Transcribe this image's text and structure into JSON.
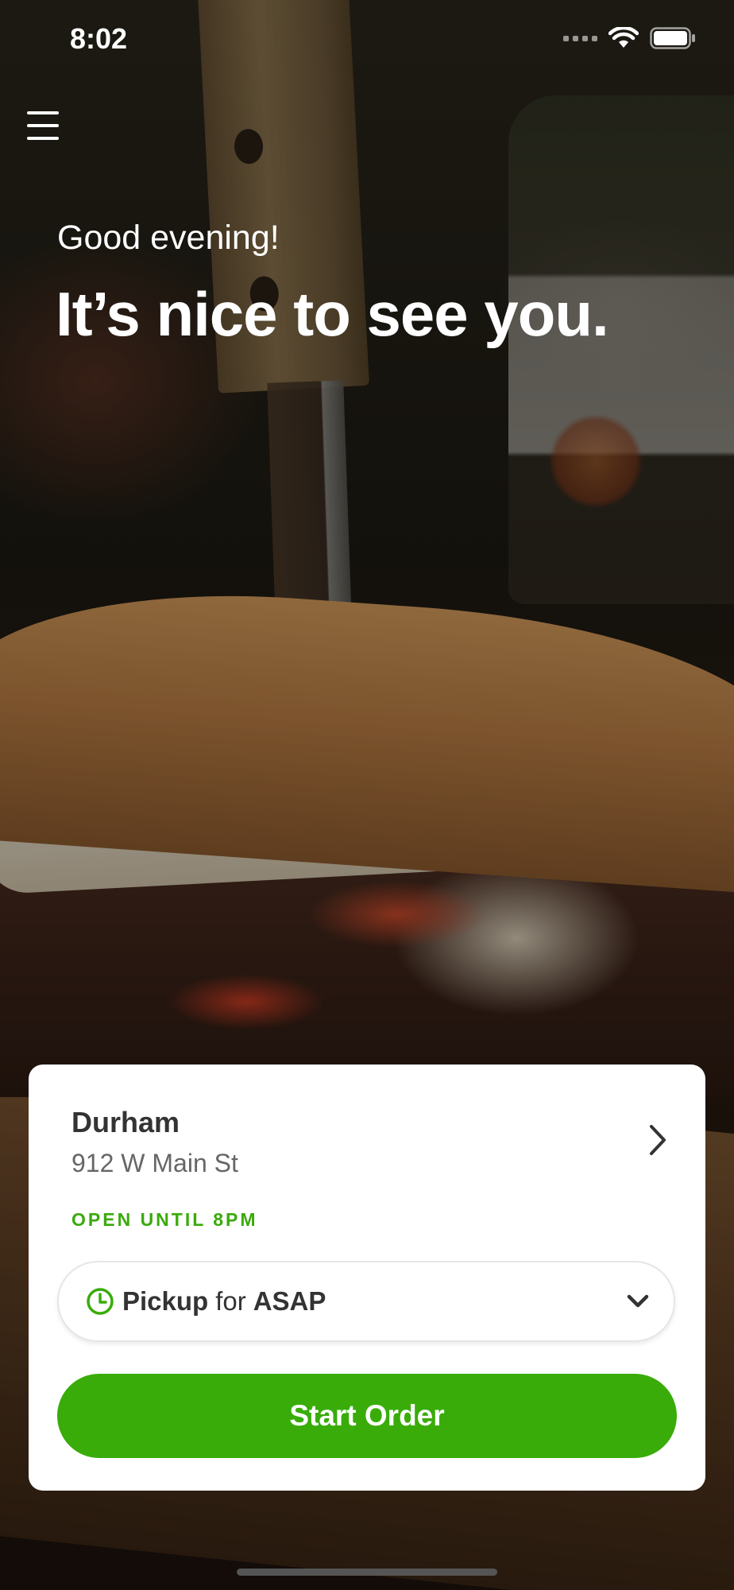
{
  "status_bar": {
    "time": "8:02",
    "icons": [
      "cellular-signal-icon",
      "wifi-icon",
      "battery-icon"
    ]
  },
  "header": {
    "menu_icon": "hamburger-menu-icon",
    "greeting": "Good evening!",
    "headline": "It’s nice to see you."
  },
  "location_card": {
    "store_name": "Durham",
    "address": "912 W Main St",
    "open_status": "OPEN UNTIL 8PM",
    "chevron_icon": "chevron-right-icon",
    "order_type": {
      "icon": "clock-icon",
      "mode": "Pickup",
      "connector": "for",
      "time": "ASAP",
      "dropdown_icon": "chevron-down-icon"
    },
    "start_button_label": "Start Order"
  },
  "colors": {
    "accent": "#39ac0a",
    "open_text": "#3aaa0c",
    "card_bg": "#ffffff"
  }
}
